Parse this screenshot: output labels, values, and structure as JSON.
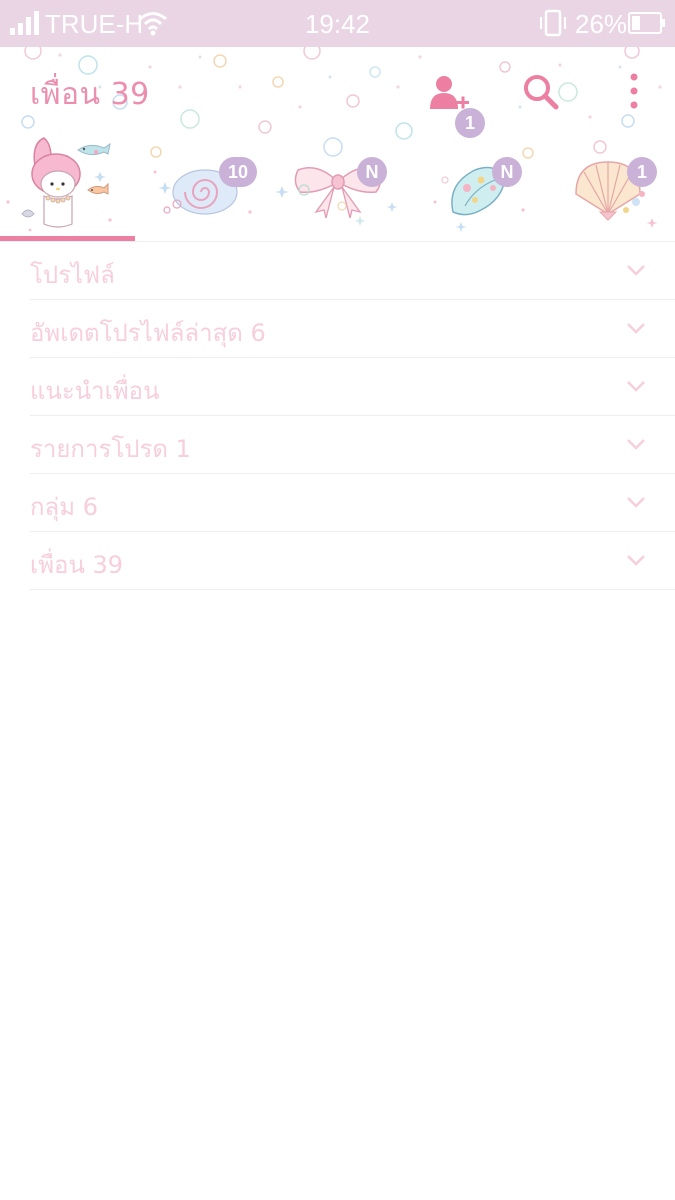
{
  "status_bar": {
    "carrier": "TRUE-H",
    "time": "19:42",
    "battery": "26%"
  },
  "header": {
    "title": "เพื่อน 39",
    "add_friend_badge": "1"
  },
  "tabs": [
    {
      "name": "friends",
      "badge": ""
    },
    {
      "name": "chats",
      "badge": "10"
    },
    {
      "name": "timeline",
      "badge": "N"
    },
    {
      "name": "news",
      "badge": "N"
    },
    {
      "name": "more",
      "badge": "1"
    }
  ],
  "list": [
    {
      "label": "โปรไฟล์"
    },
    {
      "label": "อัพเดตโปรไฟล์ล่าสุด 6"
    },
    {
      "label": "แนะนำเพื่อน"
    },
    {
      "label": "รายการโปรด 1"
    },
    {
      "label": "กลุ่ม 6"
    },
    {
      "label": "เพื่อน 39"
    }
  ],
  "colors": {
    "accent": "#ec7fa2",
    "status_bar": "#e9d5e3",
    "badge": "#c9b1d8",
    "row_text": "#f7cfdc"
  },
  "icons": [
    "signal-icon",
    "wifi-icon",
    "vibrate-icon",
    "battery-icon",
    "add-friend-icon",
    "search-icon",
    "more-vert-icon",
    "chevron-down-icon"
  ]
}
